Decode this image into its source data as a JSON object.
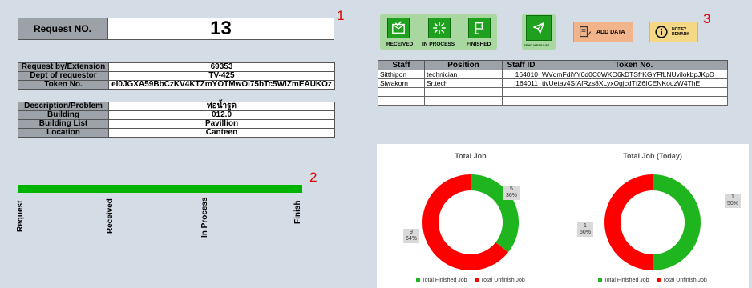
{
  "request": {
    "label": "Request NO.",
    "number": "13",
    "marker": "1"
  },
  "requester_table": [
    {
      "key": "Request by/Extension",
      "value": "69353"
    },
    {
      "key": "Dept of requestor",
      "value": "TV-425"
    },
    {
      "key": "Token No.",
      "value": "eI0JGXA59BbCzKV4KTZmYOTMwOi75bTc5WIZmEAUKOz"
    }
  ],
  "location_table": [
    {
      "key": "Description/Problem",
      "value": "ท่อน้ำรูด"
    },
    {
      "key": "Building",
      "value": "012.0"
    },
    {
      "key": "Building List",
      "value": "Pavillion"
    },
    {
      "key": "Location",
      "value": "Canteen"
    }
  ],
  "progress": {
    "marker": "2",
    "fraction": 1.0,
    "stages": [
      "Request",
      "Received",
      "In Process",
      "Finish"
    ]
  },
  "status_buttons": {
    "received": "RECEIVED",
    "in_process": "IN PROCESS",
    "finished": "FINISHED",
    "send_message": "SEND MESSAGE",
    "add_data": "ADD DATA",
    "notify_line1": "NOTIFY",
    "notify_line2": "REMARK",
    "marker": "3"
  },
  "staff_table": {
    "headers": [
      "Staff",
      "Position",
      "Staff ID",
      "Token No."
    ],
    "rows": [
      [
        "Sitthipon",
        "technician",
        "164010",
        "WVqmFdiYY0d0C0WKO6kDTSfrKGYFfLNUvilokbpJKpD"
      ],
      [
        "Siwakorn",
        "Sr,tech",
        "164011",
        "tivUetav4SfAfRzs8XLyxOgjcdTfZ6ICENKouzW4ThE"
      ],
      [
        "",
        "",
        "",
        ""
      ],
      [
        "",
        "",
        "",
        ""
      ]
    ]
  },
  "chart_data": [
    {
      "type": "pie",
      "title": "Total Job",
      "categories": [
        "Total Finished Job",
        "Total Unfinish Job"
      ],
      "values": [
        5,
        9
      ],
      "percent_labels": [
        "36%",
        "64%"
      ],
      "colors": [
        "#1fb51f",
        "#ff0000"
      ]
    },
    {
      "type": "pie",
      "title": "Total Job (Today)",
      "categories": [
        "Total Finished Job",
        "Total Unfinish Job"
      ],
      "values": [
        1,
        1
      ],
      "percent_labels": [
        "50%",
        "50%"
      ],
      "colors": [
        "#1fb51f",
        "#ff0000"
      ]
    }
  ]
}
